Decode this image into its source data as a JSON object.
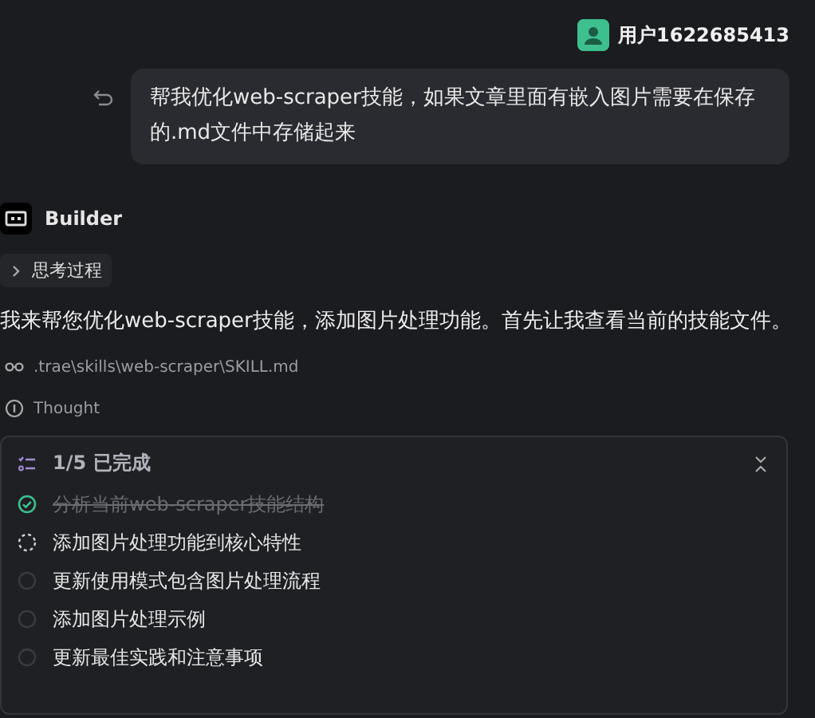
{
  "user": {
    "name": "用户1622685413"
  },
  "message": {
    "text": "帮我优化web-scraper技能，如果文章里面有嵌入图片需要在保存的.md文件中存储起来"
  },
  "agent": {
    "name": "Builder"
  },
  "thinking": {
    "label": "思考过程",
    "expanded": false
  },
  "reply": "我来帮您优化web-scraper技能，添加图片处理功能。首先让我查看当前的技能文件。",
  "file_read": {
    "path": ".trae\\skills\\web-scraper\\SKILL.md"
  },
  "thought": {
    "label": "Thought"
  },
  "todo": {
    "title": "1/5 已完成",
    "items": [
      {
        "text": "分析当前web-scraper技能结构",
        "kind": "done"
      },
      {
        "text": "添加图片处理功能到核心特性",
        "kind": "active"
      },
      {
        "text": "更新使用模式包含图片处理流程",
        "kind": "pending"
      },
      {
        "text": "添加图片处理示例",
        "kind": "pending"
      },
      {
        "text": "更新最佳实践和注意事项",
        "kind": "pending"
      }
    ]
  }
}
